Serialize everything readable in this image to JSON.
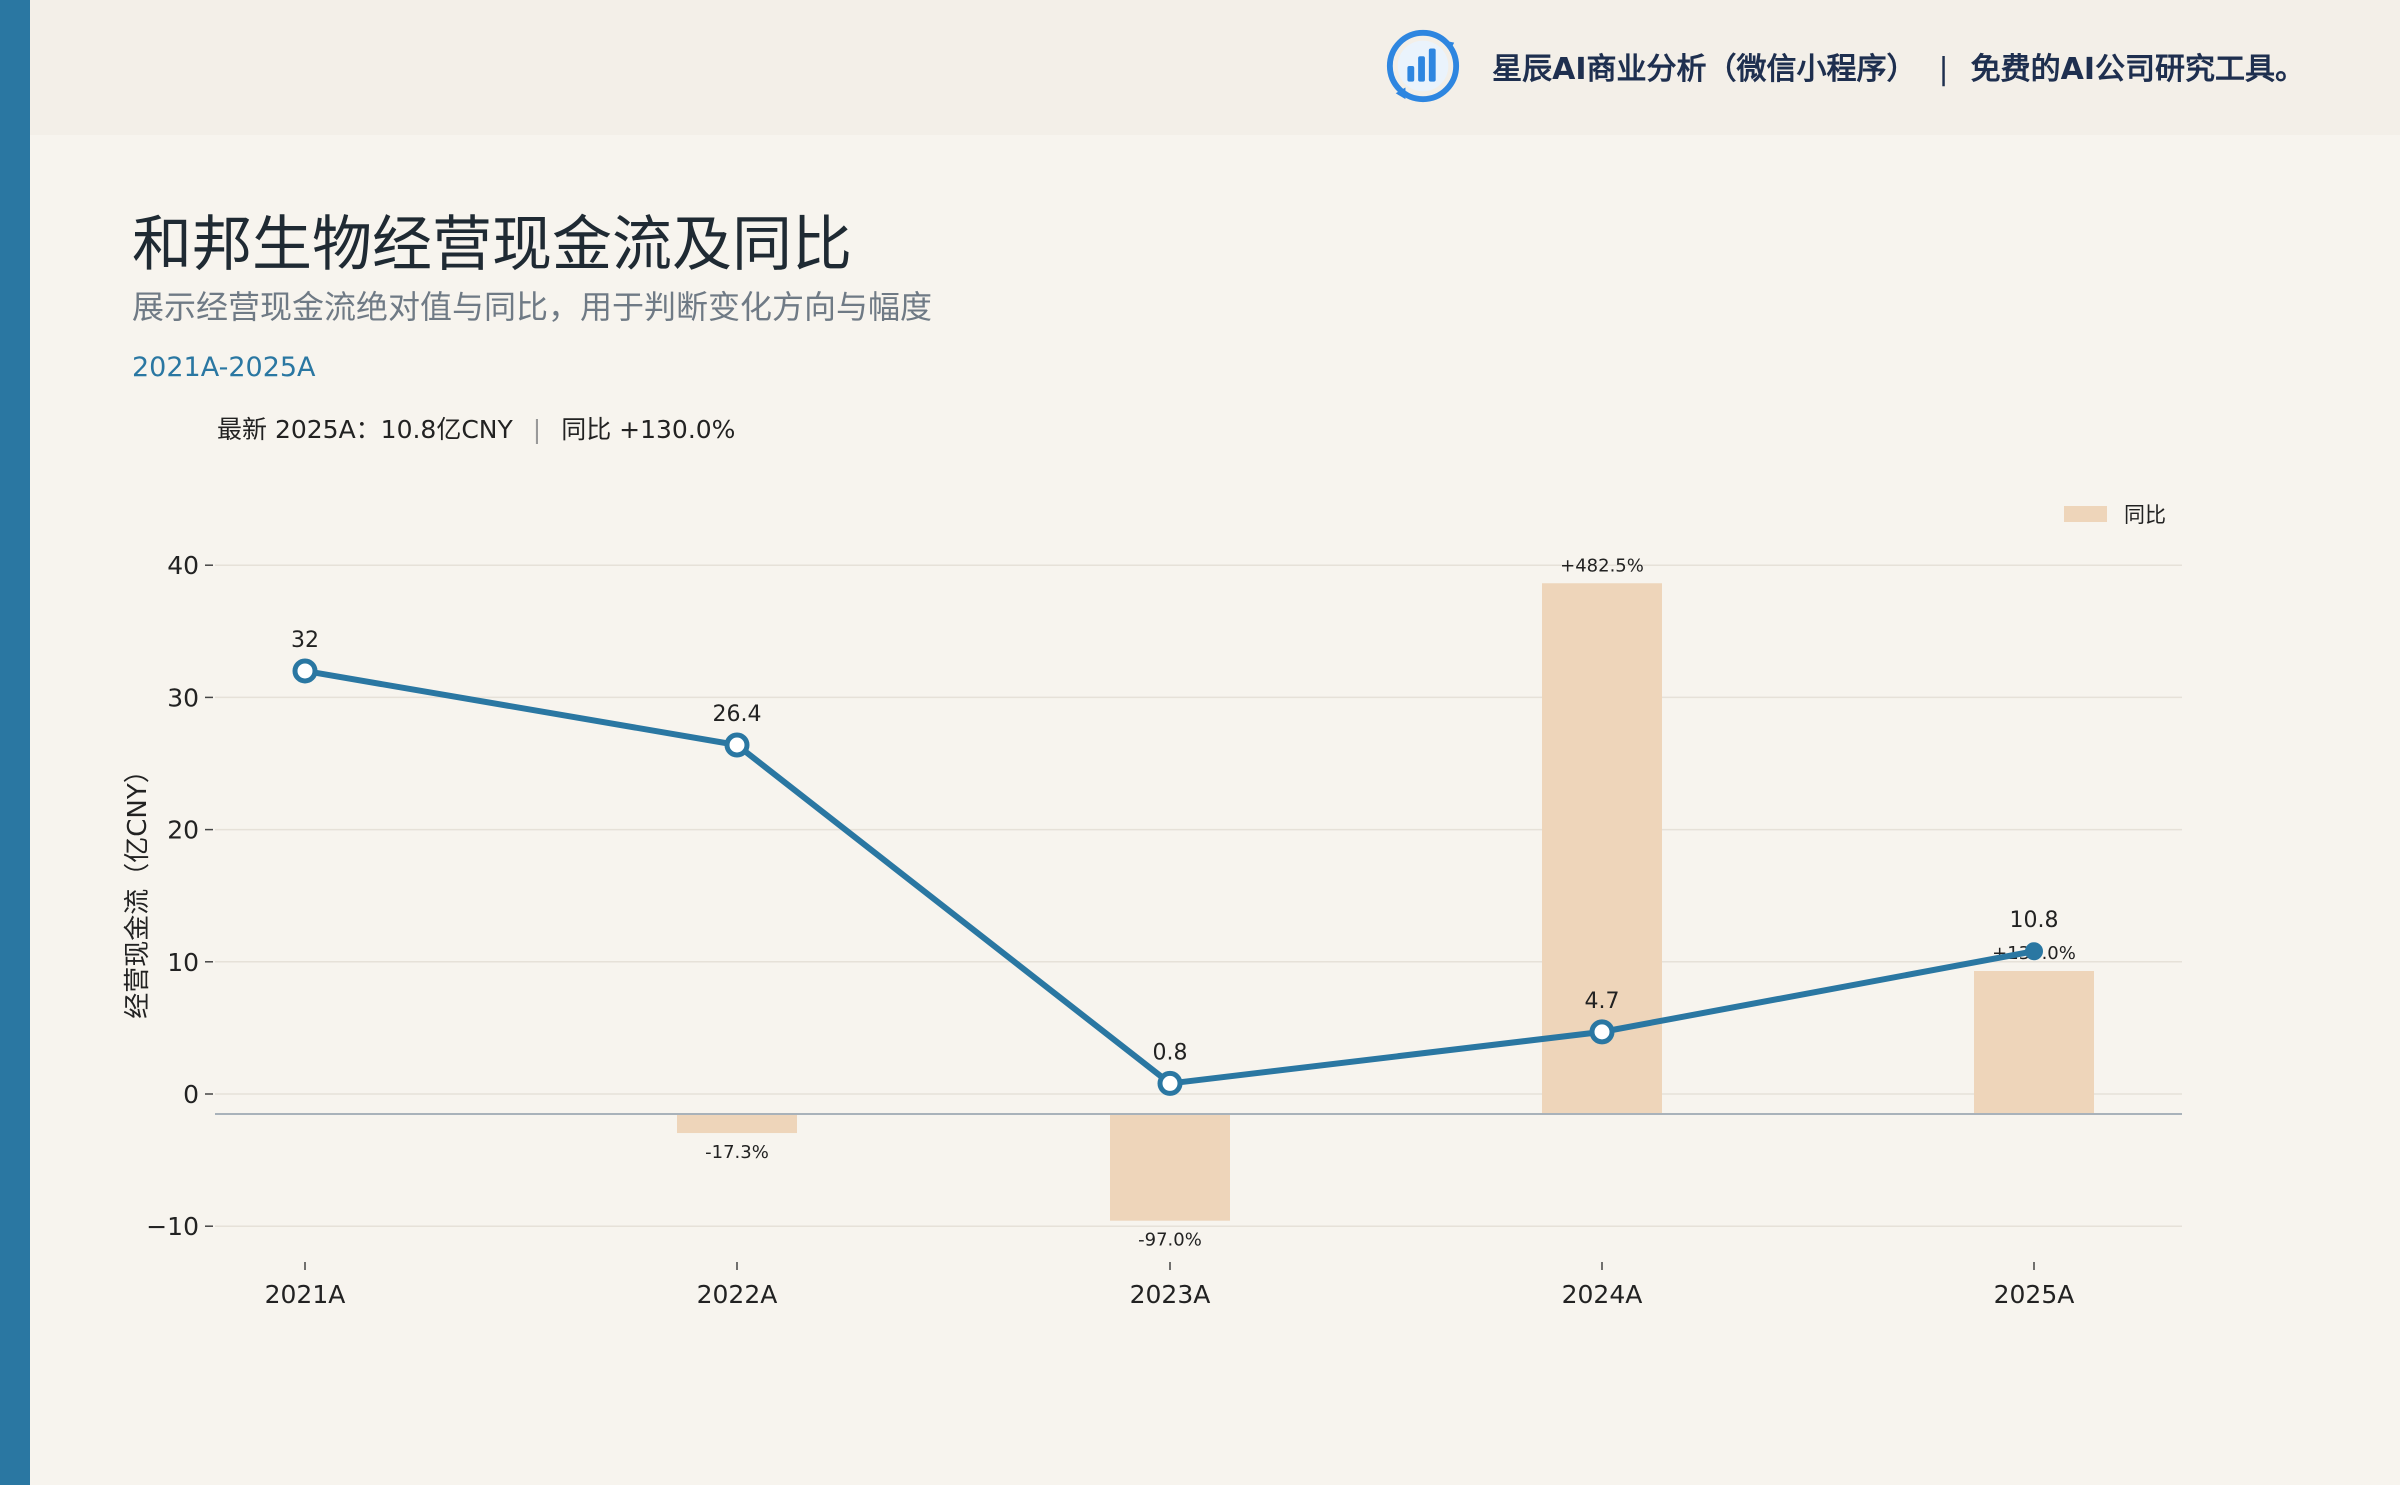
{
  "header": {
    "brand": "星辰AI商业分析（微信小程序）",
    "separator": "|",
    "tagline": "免费的AI公司研究工具。",
    "logo_icon": "bar-chart-refresh-icon"
  },
  "title": "和邦生物经营现金流及同比",
  "subtitle": "展示经营现金流绝对值与同比，用于判断变化方向与幅度",
  "period": "2021A-2025A",
  "latest": {
    "label": "最新 2025A：10.8亿CNY",
    "separator": "|",
    "yoy": "同比 +130.0%"
  },
  "colors": {
    "line": "#2a77a2",
    "bar": "#eed5ba",
    "accent": "#2a77a2"
  },
  "chart_data": {
    "type": "line",
    "categories": [
      "2021A",
      "2022A",
      "2023A",
      "2024A",
      "2025A"
    ],
    "ylabel": "经营现金流（亿CNY）",
    "ylim": [
      -13,
      46
    ],
    "yticks": [
      -10,
      0,
      10,
      20,
      30,
      40
    ],
    "ytick_labels": [
      "−10",
      "0",
      "10",
      "20",
      "30",
      "40"
    ],
    "grid": true,
    "legend": {
      "position": "top-right",
      "items": [
        "同比"
      ]
    },
    "series": [
      {
        "type": "line",
        "values": [
          32.0,
          26.4,
          0.8,
          4.7,
          10.8
        ],
        "labels": [
          "32",
          "26.4",
          "0.8",
          "4.7",
          "10.8"
        ]
      },
      {
        "name": "同比",
        "type": "bar",
        "axis": "secondary",
        "values": [
          null,
          -17.3,
          -97.0,
          482.5,
          130.0
        ],
        "labels": [
          "",
          "-17.3%",
          "-97.0%",
          "+482.5%",
          "+130.0%"
        ]
      }
    ]
  }
}
